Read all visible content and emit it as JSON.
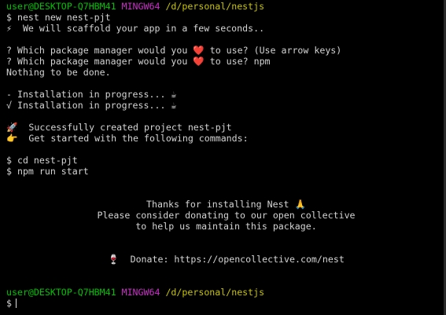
{
  "prompt1": {
    "user": "user@DESKTOP-Q7HBM41",
    "shell": "MINGW64",
    "path": "/d/personal/nestjs"
  },
  "lines": {
    "cmd1": "$ nest new nest-pjt",
    "scaffold_icon": "⚡",
    "scaffold_text": "  We will scaffold your app in a few seconds..",
    "q1_a": "? Which package manager would you ",
    "q1_heart": "❤️",
    "q1_b": " to use? (Use arrow keys)",
    "q2_a": "? Which package manager would you ",
    "q2_heart": "❤️",
    "q2_b": " to use? npm",
    "nothing": "Nothing to be done.",
    "install1": "- Installation in progress... ",
    "install1_icon": "☕",
    "install2": "√ Installation in progress... ",
    "install2_icon": "☕",
    "success_icon": "🚀",
    "success_text": "  Successfully created project nest-pjt",
    "started_icon": "👉",
    "started_text": "  Get started with the following commands:",
    "cd_cmd": "$ cd nest-pjt",
    "npm_cmd": "$ npm run start",
    "thanks": "Thanks for installing Nest ",
    "thanks_icon": "🙏",
    "donate_line": "Please consider donating to our open collective",
    "maintain_line": "to help us maintain this package.",
    "donate_icon": "🍷",
    "donate_text": "  Donate: https://opencollective.com/nest"
  },
  "prompt2": {
    "user": "user@DESKTOP-Q7HBM41",
    "shell": "MINGW64",
    "path": "/d/personal/nestjs",
    "dollar": "$"
  }
}
